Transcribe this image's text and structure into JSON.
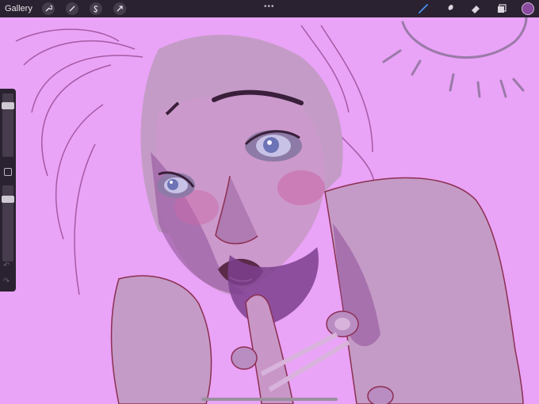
{
  "topbar": {
    "gallery_label": "Gallery",
    "left_tools": [
      "wrench-icon",
      "magic-wand-icon",
      "selection-icon",
      "transform-arrow-icon"
    ],
    "more_label": "•••",
    "right_tools": [
      "brush-icon",
      "smudge-icon",
      "eraser-icon",
      "layers-icon"
    ],
    "current_color": "#8a4aa0"
  },
  "sidebar": {
    "brush_size": 0.85,
    "opacity": 0.85,
    "undo_label": "↶",
    "redo_label": "↷"
  },
  "colors": {
    "canvas_bg": "#e9a3f7",
    "ui_bar": "#2a2230",
    "line": "#8c2f52",
    "skin": "#c995c6",
    "shadow": "#7d3f8e"
  }
}
